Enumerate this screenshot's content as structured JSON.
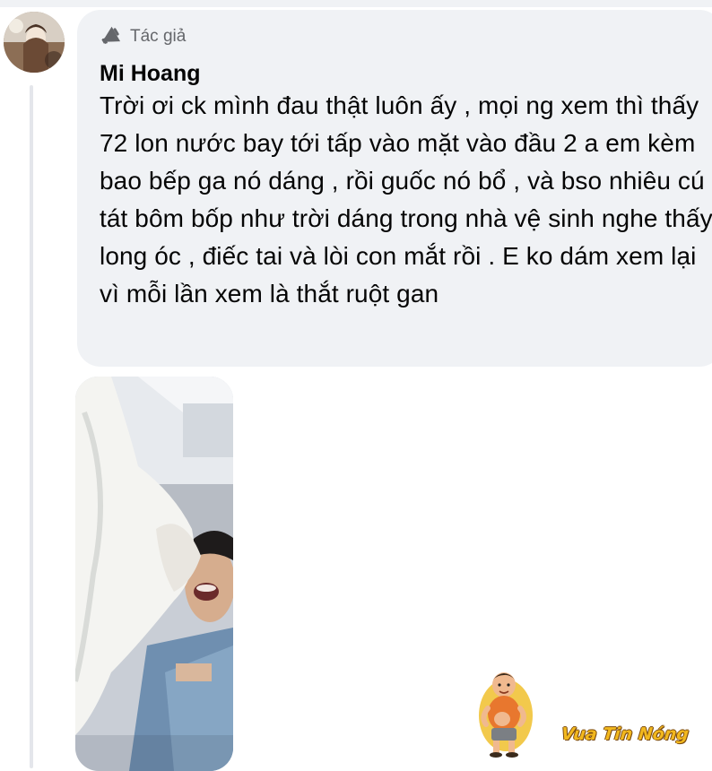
{
  "comment": {
    "badge_label": "Tác giả",
    "badge_icon": "megaphone-icon",
    "author_name": "Mi Hoang",
    "text": "Trời ơi ck mình đau thật luôn ấy , mọi ng xem thì thấy 72 lon nước bay tới tấp vào mặt vào đầu 2 a em kèm bao bếp ga nó dáng , rồi guốc nó bổ , và bso nhiêu cú tát bôm bốp như trời dáng trong nhà vệ sinh nghe thấy long óc , điếc tai và lòi con mắt rồi . E ko dám xem lại vì mỗi lần xem là thắt ruột gan"
  },
  "watermark": {
    "text": "Vua Tin Nóng"
  },
  "colors": {
    "bubble_bg": "#f0f2f5",
    "secondary_text": "#65676b",
    "primary_text": "#050505",
    "thread_line": "#e4e6eb",
    "watermark_gold": "#f2b81e"
  }
}
